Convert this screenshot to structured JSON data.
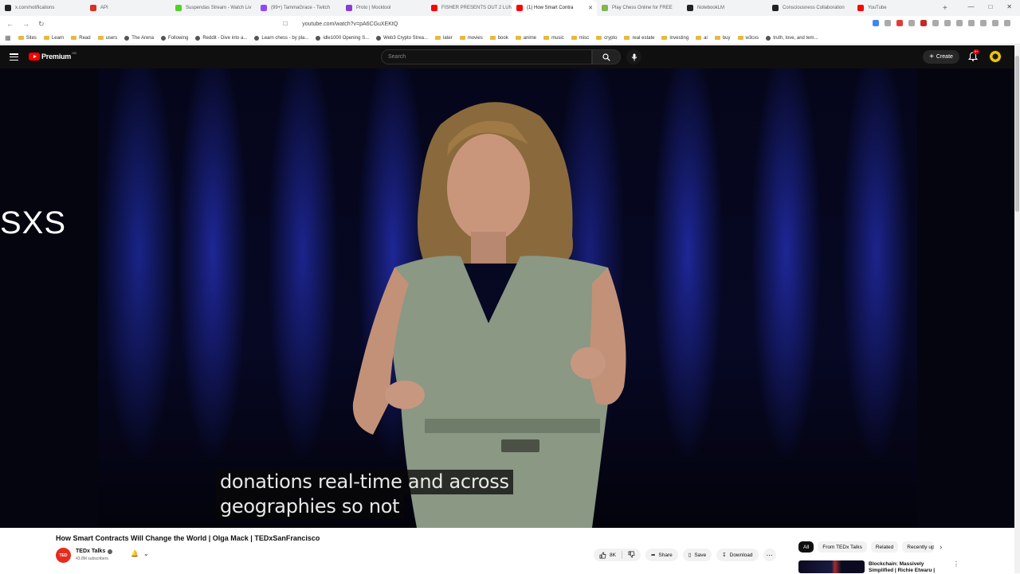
{
  "browser": {
    "tabs": [
      {
        "label": "x.com/notifications",
        "color": "#222222"
      },
      {
        "label": "API",
        "color": "#d93025"
      },
      {
        "label": "Suspendas Stream - Watch Liv",
        "color": "#53d127"
      },
      {
        "label": "(99+) TammaGrace - Twitch",
        "color": "#9146ff"
      },
      {
        "label": "Proto | Mocktool",
        "color": "#8b3bd6"
      },
      {
        "label": "FISHER PRESENTS OUT 2 LUN",
        "color": "#ff0000"
      },
      {
        "label": "(1) How Smart Contra",
        "color": "#ff0000",
        "active": true
      },
      {
        "label": "Play Chess Online for FREE",
        "color": "#81b64c"
      },
      {
        "label": "NotebookLM",
        "color": "#222222"
      },
      {
        "label": "Consciousness Collaboration",
        "color": "#222222"
      },
      {
        "label": "YouTube",
        "color": "#ff0000"
      }
    ],
    "new_tab": "+",
    "url": "youtube.com/watch?v=pA6CGuXEKtQ",
    "bookmarks": [
      {
        "label": "Sites",
        "kind": "folder"
      },
      {
        "label": "Learn",
        "kind": "folder"
      },
      {
        "label": "Read",
        "kind": "folder"
      },
      {
        "label": "users",
        "kind": "folder"
      },
      {
        "label": "The Arena",
        "kind": "link"
      },
      {
        "label": "Following",
        "kind": "link"
      },
      {
        "label": "Reddit - Dive into a...",
        "kind": "link"
      },
      {
        "label": "Learn chess - by pla...",
        "kind": "link"
      },
      {
        "label": "idle1000 Opening S...",
        "kind": "link"
      },
      {
        "label": "Web3 Crypto Strea...",
        "kind": "link"
      },
      {
        "label": "later",
        "kind": "folder"
      },
      {
        "label": "movies",
        "kind": "folder"
      },
      {
        "label": "book",
        "kind": "folder"
      },
      {
        "label": "anime",
        "kind": "folder"
      },
      {
        "label": "music",
        "kind": "folder"
      },
      {
        "label": "misc",
        "kind": "folder"
      },
      {
        "label": "crypto",
        "kind": "folder"
      },
      {
        "label": "real estate",
        "kind": "folder"
      },
      {
        "label": "investing",
        "kind": "folder"
      },
      {
        "label": "ai",
        "kind": "folder"
      },
      {
        "label": "buy",
        "kind": "folder"
      },
      {
        "label": "w3cxs",
        "kind": "folder"
      },
      {
        "label": "truth, love, and tem...",
        "kind": "link"
      }
    ]
  },
  "youtube": {
    "logo_text": "Premium",
    "logo_region": "GB",
    "search_placeholder": "Search",
    "create_label": "Create",
    "notif_count": "9+"
  },
  "player": {
    "overlay_text": "SXS",
    "caption_line1": "donations real-time and across",
    "caption_line2": "geographies so not"
  },
  "video": {
    "title": "How Smart Contracts Will Change the World | Olga Mack | TEDxSanFrancisco",
    "channel_avatar_text": "TED",
    "channel_name": "TEDx Talks",
    "subscribers": "43.8M subscribers",
    "likes": "8K",
    "share_label": "Share",
    "save_label": "Save",
    "download_label": "Download"
  },
  "sidebar": {
    "chips": [
      "All",
      "From TEDx Talks",
      "Related",
      "Recently up"
    ],
    "rec_title": "Blockchain: Massively Simplified | Richie Etwaru |"
  }
}
